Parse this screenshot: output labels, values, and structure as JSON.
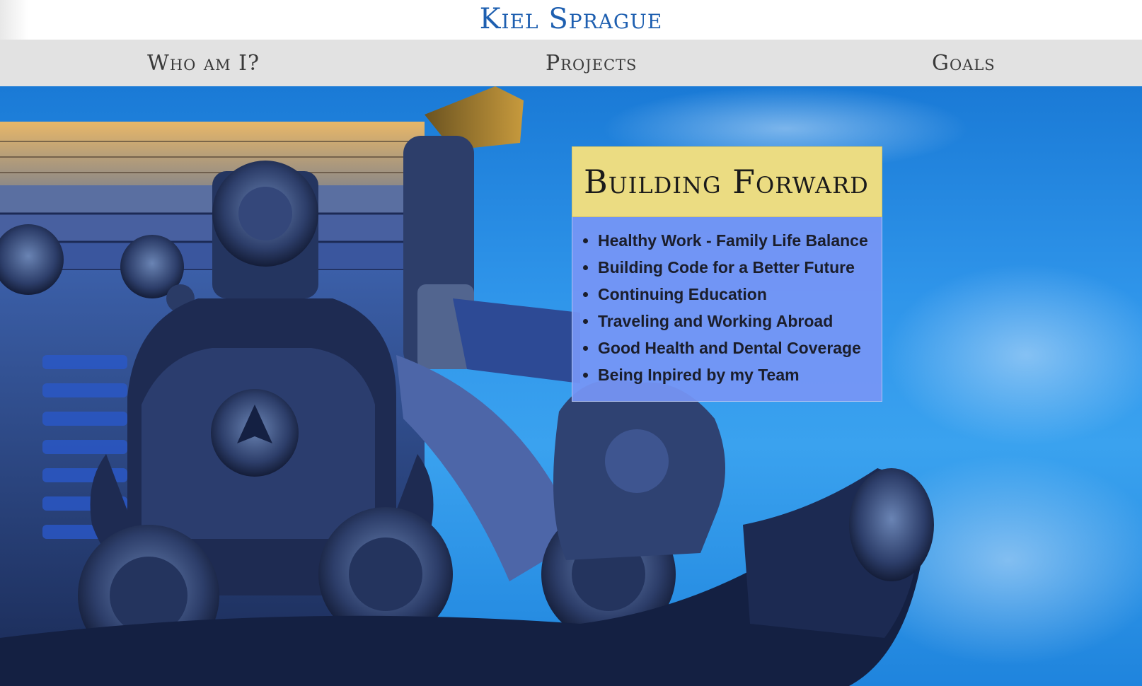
{
  "header": {
    "title": "Kiel Sprague"
  },
  "nav": {
    "items": [
      {
        "label": "Who am I?"
      },
      {
        "label": "Projects"
      },
      {
        "label": "Goals"
      }
    ]
  },
  "hero": {
    "background_image": "japanese-temple-roof-tiles-image",
    "accent_sky": "#2f95ea",
    "panel": {
      "title": "Building Forward",
      "header_color": "#ebdc82",
      "body_color": "#7696f5",
      "goals": [
        "Healthy Work - Family Life Balance",
        "Building Code for a Better Future",
        "Continuing Education",
        "Traveling and Working Abroad",
        "Good Health and Dental Coverage",
        "Being Inpired by my Team"
      ]
    }
  }
}
